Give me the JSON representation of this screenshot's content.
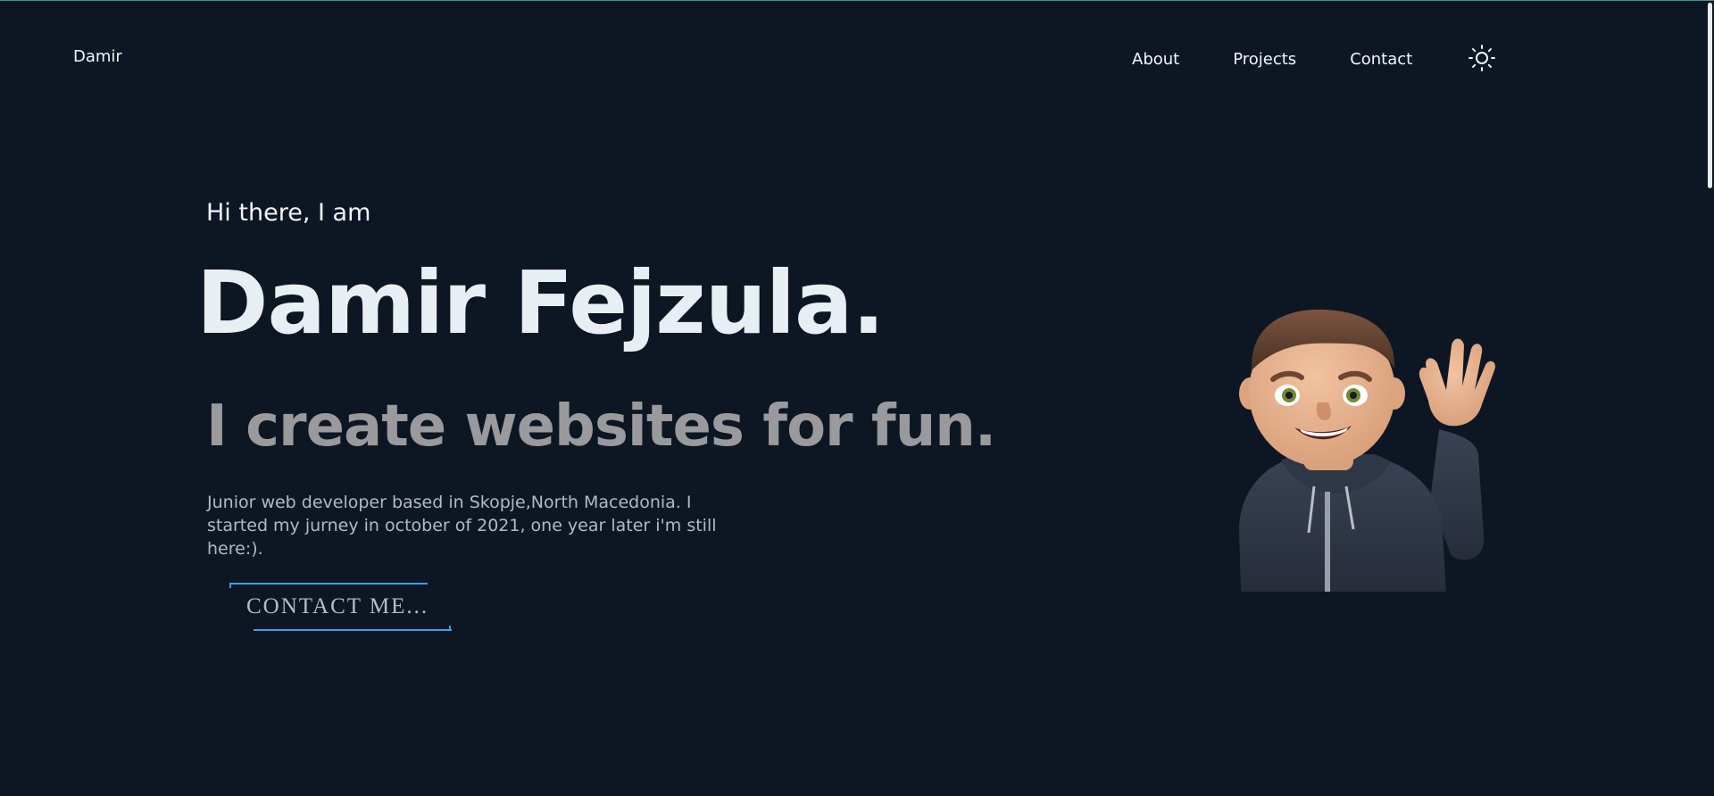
{
  "header": {
    "brand": "Damir",
    "nav": [
      {
        "label": "About"
      },
      {
        "label": "Projects"
      },
      {
        "label": "Contact"
      }
    ],
    "theme_icon": "sun-icon"
  },
  "hero": {
    "greeting": "Hi there, I am",
    "name": "Damir Fejzula.",
    "tagline": "I create websites for fun.",
    "bio": "Junior web developer based in Skopje,North Macedonia. I started my jurney in october of 2021, one year later i'm still here:).",
    "cta_label": "CONTACT ME...",
    "avatar_icon": "waving-memoji-avatar"
  },
  "colors": {
    "background": "#0c1723",
    "heading": "#e8eef3",
    "tagline": "#9a9a9c",
    "accent": "#3aa0e6"
  }
}
